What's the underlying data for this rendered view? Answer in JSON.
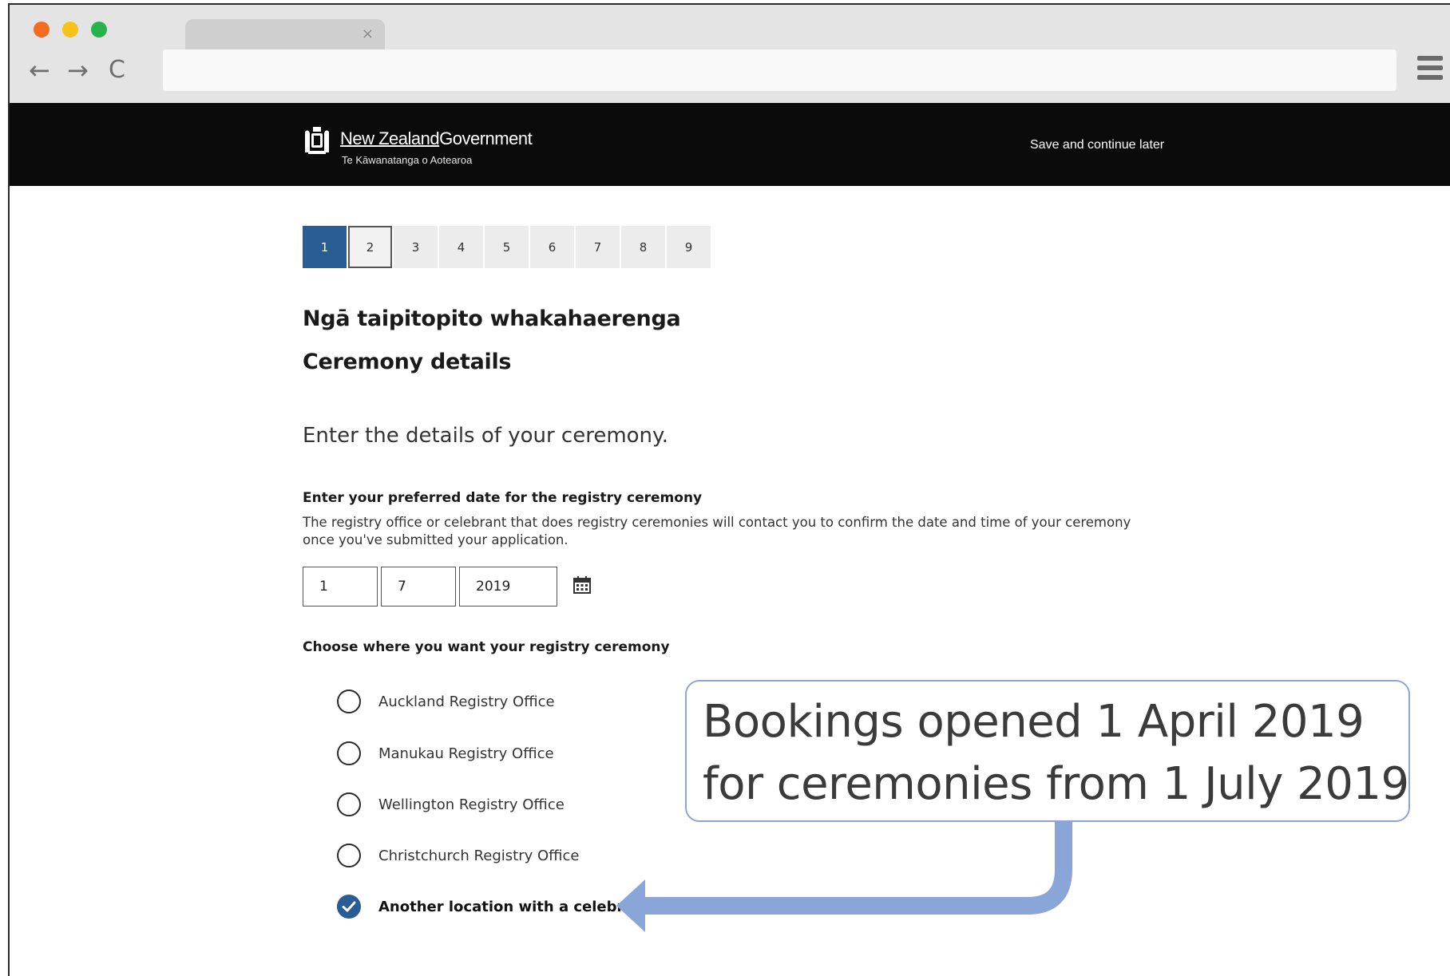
{
  "browser": {
    "tab_close_glyph": "×",
    "back_glyph": "←",
    "forward_glyph": "→",
    "reload_glyph": "C"
  },
  "header": {
    "gov_name_part1": "New Zealand",
    "gov_name_part2": "Government",
    "gov_subtitle": "Te Kāwanatanga o Aotearoa",
    "save_link": "Save and continue later"
  },
  "steps": [
    "1",
    "2",
    "3",
    "4",
    "5",
    "6",
    "7",
    "8",
    "9"
  ],
  "page": {
    "heading_maori": "Ngā taipitopito whakahaerenga",
    "heading_english": "Ceremony details",
    "intro": "Enter the details of your ceremony.",
    "date_label": "Enter your preferred date for the registry ceremony",
    "date_hint_line1": "The registry office or celebrant that does registry ceremonies will contact you to confirm the date and time of your ceremony",
    "date_hint_line2": "once you've submitted your application.",
    "date_day": "1",
    "date_month": "7",
    "date_year": "2019",
    "location_label": "Choose where you want your registry ceremony",
    "options": [
      {
        "label": "Auckland Registry Office",
        "checked": false
      },
      {
        "label": "Manukau Registry Office",
        "checked": false
      },
      {
        "label": "Wellington Registry Office",
        "checked": false
      },
      {
        "label": "Christchurch Registry Office",
        "checked": false
      },
      {
        "label": "Another location with a celebrant",
        "checked": true
      }
    ]
  },
  "callout": {
    "line1": "Bookings opened 1 April 2019",
    "line2": "for ceremonies from 1 July 2019"
  },
  "colors": {
    "accent": "#2a5d93",
    "callout_border": "#8aa6d9",
    "arrow": "#8aa6d9",
    "header_bg": "#0b0b0b"
  }
}
